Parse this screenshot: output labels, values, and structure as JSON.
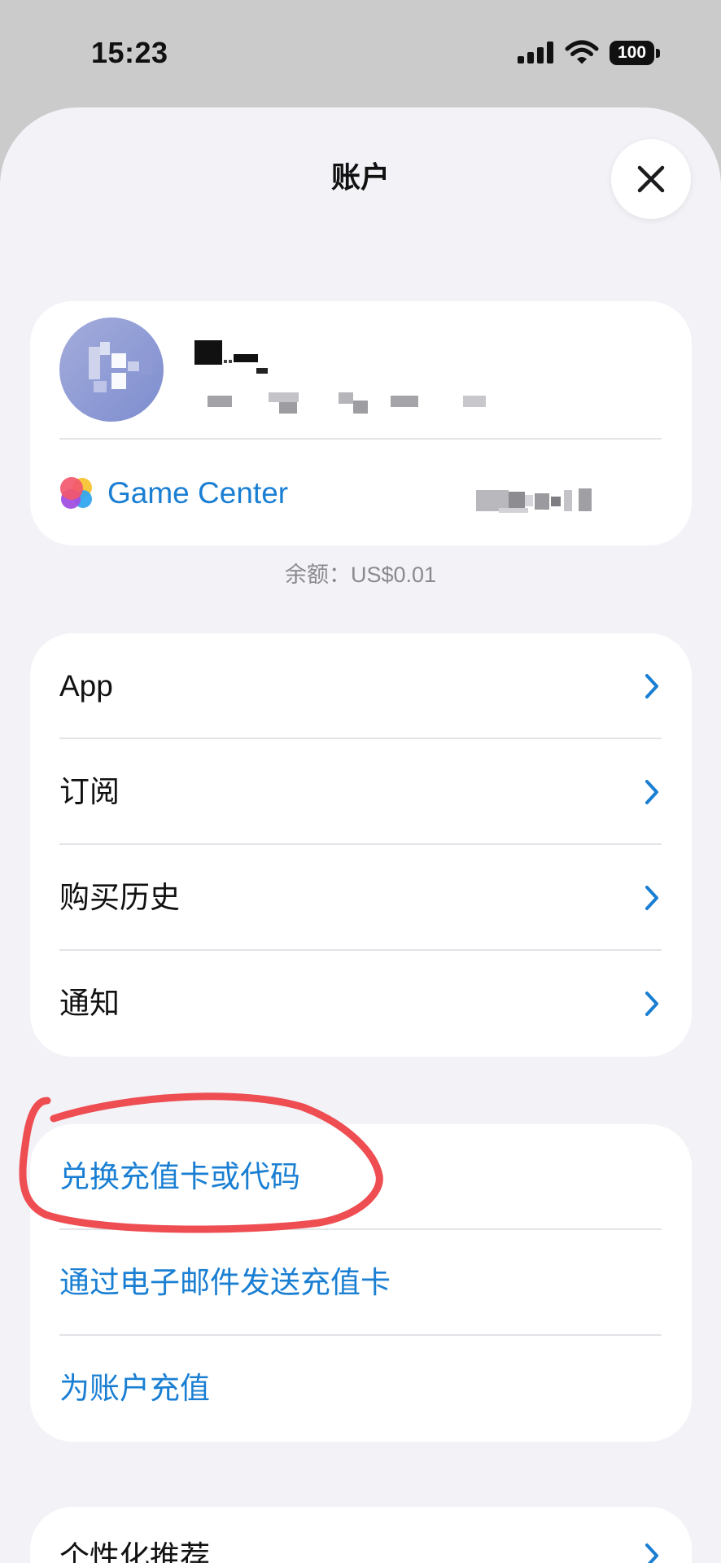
{
  "status_bar": {
    "time": "15:23",
    "battery_level": "100",
    "icons": [
      "signal-icon",
      "wifi-icon",
      "battery-icon"
    ]
  },
  "sheet": {
    "title": "账户",
    "close_icon": "close-icon"
  },
  "profile": {
    "game_center": {
      "label": "Game Center",
      "icon": "game-center-icon"
    }
  },
  "balance": "余额：US$0.01",
  "menu": {
    "items": [
      {
        "label": "App",
        "icon": "chevron-right-icon"
      },
      {
        "label": "订阅",
        "icon": "chevron-right-icon"
      },
      {
        "label": "购买历史",
        "icon": "chevron-right-icon"
      },
      {
        "label": "通知",
        "icon": "chevron-right-icon"
      }
    ]
  },
  "gift_card_actions": {
    "items": [
      {
        "label": "兑换充值卡或代码"
      },
      {
        "label": "通过电子邮件发送充值卡"
      },
      {
        "label": "为账户充值"
      }
    ]
  },
  "more": {
    "items": [
      {
        "label": "个性化推荐",
        "icon": "chevron-right-icon"
      }
    ]
  },
  "colors": {
    "accent": "#1a7fd3",
    "annotation": "#ee4d52",
    "sheet_background": "#f2f2f7",
    "backdrop": "#cbcbcb",
    "card": "#ffffff"
  }
}
